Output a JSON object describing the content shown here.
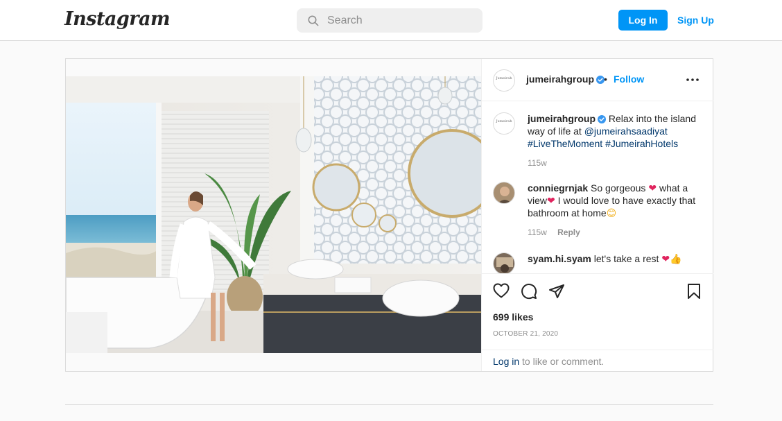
{
  "nav": {
    "logo": "Instagram",
    "search_placeholder": "Search",
    "login_label": "Log In",
    "signup_label": "Sign Up"
  },
  "post": {
    "username": "jumeirahgroup",
    "follow_label": "Follow",
    "separator": "•",
    "avatar_brand": "Jumeirah",
    "caption": {
      "username": "jumeirahgroup",
      "text": "Relax into the island way of life at",
      "mention": "@jumeirahsaadiyat",
      "hashtag1": "#LiveTheMoment",
      "hashtag2": "#JumeirahHotels",
      "time": "115w"
    },
    "comments": [
      {
        "username": "conniegrnjak",
        "text_a": "So gorgeous",
        "emoji_a": "❤",
        "text_b": "what a view",
        "emoji_b": "❤",
        "text_c": "I would love to have exactly that bathroom at home",
        "emoji_c": "😊",
        "time": "115w",
        "reply_label": "Reply"
      },
      {
        "username": "syam.hi.syam",
        "text_a": "let's take a rest",
        "emoji_a": "❤",
        "emoji_b": "👍"
      }
    ],
    "likes": "699 likes",
    "date": "October 21, 2020",
    "login_link": "Log in",
    "login_suffix": "to like or comment."
  },
  "colors": {
    "accent": "#0095f6",
    "link": "#00376b",
    "heart": "#e0245e",
    "border": "#dbdbdb",
    "background": "#fafafa"
  },
  "icons": [
    "search-icon",
    "verified-badge-icon",
    "more-options-icon",
    "heart-icon",
    "comment-icon",
    "share-icon",
    "bookmark-icon"
  ]
}
